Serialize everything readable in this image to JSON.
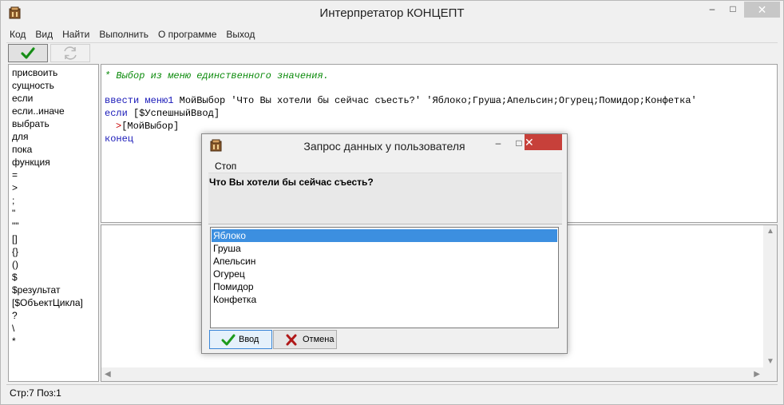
{
  "window": {
    "title": "Интерпретатор КОНЦЕПТ",
    "min_glyph": "‒",
    "max_glyph": "□",
    "close_glyph": "✕"
  },
  "menu": [
    "Код",
    "Вид",
    "Найти",
    "Выполнить",
    "О программе",
    "Выход"
  ],
  "keywords": [
    "присвоить",
    "сущность",
    "если",
    "если..иначе",
    "выбрать",
    "для",
    "пока",
    "функция",
    "=",
    ">",
    ";",
    "\"",
    "\"\"",
    "[]",
    "{}",
    "()",
    "$",
    "$результат",
    "[$ОбъектЦикла]",
    "?",
    "\\",
    "*"
  ],
  "code": {
    "comment": "* Выбор из меню единственного значения.",
    "line2_kw": "ввести меню",
    "line2_num": "1",
    "line2_rest": " МойВыбор 'Что Вы хотели бы сейчас съесть?' 'Яблоко;Груша;Апельсин;Огурец;Помидор;Конфетка'",
    "line3_kw": "если",
    "line3_rest": " [$УспешныйВвод]",
    "line4_marker": ">",
    "line4_rest": "[МойВыбор]",
    "line5_kw": "конец"
  },
  "status": "Стр:7 Поз:1",
  "dialog": {
    "title": "Запрос данных у пользователя",
    "menu_stop": "Стоп",
    "question": "Что Вы хотели бы сейчас съесть?",
    "options": [
      "Яблоко",
      "Груша",
      "Апельсин",
      "Огурец",
      "Помидор",
      "Конфетка"
    ],
    "selected_index": 0,
    "ok_label": "Ввод",
    "cancel_label": "Отмена",
    "min_glyph": "‒",
    "max_glyph": "□",
    "close_glyph": "✕"
  },
  "colors": {
    "comment": "#0a8a0a",
    "keyword": "#1818b8",
    "marker": "#c80000",
    "selection": "#3c8fe0",
    "close_active": "#c7403a"
  },
  "icons": {
    "run": "checkmark-icon",
    "reload": "refresh-icon",
    "app": "app-icon",
    "ok": "checkmark-icon",
    "cancel": "cross-icon"
  }
}
